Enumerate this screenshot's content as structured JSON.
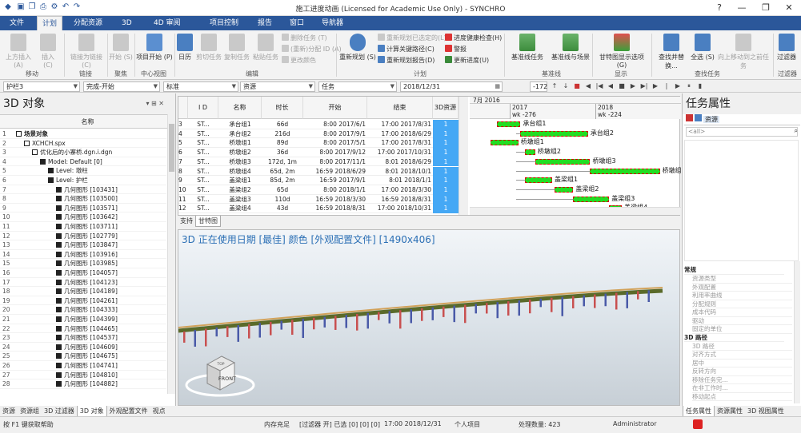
{
  "window": {
    "title": "施工进度动画 (Licensed for Academic Use Only) - SYNCHRO",
    "help": "?",
    "minimize": "—",
    "restore": "❐",
    "close": "✕"
  },
  "quick_access": [
    "save-icon",
    "open-icon",
    "print-icon",
    "settings-icon",
    "undo-icon",
    "redo-icon"
  ],
  "quick_access_glyphs": [
    "▣",
    "❐",
    "⎙",
    "⚙",
    "↶",
    "↷"
  ],
  "menu_tabs": [
    "文件",
    "计划",
    "分配资源",
    "3D",
    "4D 审阅",
    "项目控制",
    "报告",
    "窗口",
    "导航器"
  ],
  "active_tab": "计划",
  "ribbon": {
    "groups": [
      {
        "label": "移动",
        "buttons": [
          "上方插入 (A)",
          "插入 (C)"
        ]
      },
      {
        "label": "链接",
        "buttons": [
          "取消链接",
          "链接为链接 (C)"
        ]
      },
      {
        "label": "聚焦",
        "buttons": [
          "开始 (S)"
        ]
      },
      {
        "label": "中心视图",
        "buttons": [
          "项目开始 (P)"
        ]
      },
      {
        "label": "编辑",
        "buttons": [
          "日历",
          "剪切任务",
          "复制任务",
          "粘贴任务"
        ]
      },
      {
        "label": "计划",
        "buttons": [
          "重新规划 (S)"
        ]
      },
      {
        "label": "基准线",
        "buttons": [
          "基准线任务",
          "基准线与场景",
          "基准线"
        ]
      },
      {
        "label": "显示",
        "buttons": [
          "甘特图显示选项 (G)"
        ]
      },
      {
        "label": "查找任务",
        "buttons": [
          "查找并替换...",
          "全选 (S)",
          "向上移动到之前任务"
        ]
      },
      {
        "label": "过滤器",
        "buttons": [
          "过滤器"
        ]
      }
    ],
    "small": {
      "edit": [
        "删除任务 (T)",
        "(重新)分配 ID (A)",
        "更改颜色"
      ],
      "plan": [
        "重新规划已选定的(L)",
        "计算关键路径(C)",
        "重新规划报告(D)"
      ],
      "health": [
        "进度健康检查(H)",
        "警报",
        "更新进度(U)"
      ]
    }
  },
  "toolbar": {
    "obj": "护栏3",
    "status": "完成-开始",
    "std": "标准",
    "res": "资源",
    "task": "任务",
    "date": "2018/12/31",
    "num": "-172"
  },
  "left_panel": {
    "title": "3D 对象",
    "column": "名称",
    "rows": [
      {
        "n": "1",
        "t": "场景对象",
        "d": 0,
        "b": true
      },
      {
        "n": "2",
        "t": "XCHCH.spx",
        "d": 1
      },
      {
        "n": "3",
        "t": "优化后的小寨桥.dgn.i.dgn",
        "d": 2
      },
      {
        "n": "4",
        "t": "Model: Default [0]",
        "d": 3
      },
      {
        "n": "5",
        "t": "Level: 墩柱",
        "d": 4
      },
      {
        "n": "6",
        "t": "Level: 护栏",
        "d": 4
      },
      {
        "n": "7",
        "t": "几何图形 [103431]",
        "d": 5
      },
      {
        "n": "8",
        "t": "几何图形 [103500]",
        "d": 5
      },
      {
        "n": "9",
        "t": "几何图形 [103571]",
        "d": 5
      },
      {
        "n": "10",
        "t": "几何图形 [103642]",
        "d": 5
      },
      {
        "n": "11",
        "t": "几何图形 [103711]",
        "d": 5
      },
      {
        "n": "12",
        "t": "几何图形 [102779]",
        "d": 5
      },
      {
        "n": "13",
        "t": "几何图形 [103847]",
        "d": 5
      },
      {
        "n": "14",
        "t": "几何图形 [103916]",
        "d": 5
      },
      {
        "n": "15",
        "t": "几何图形 [103985]",
        "d": 5
      },
      {
        "n": "16",
        "t": "几何图形 [104057]",
        "d": 5
      },
      {
        "n": "17",
        "t": "几何图形 [104123]",
        "d": 5
      },
      {
        "n": "18",
        "t": "几何图形 [104189]",
        "d": 5
      },
      {
        "n": "19",
        "t": "几何图形 [104261]",
        "d": 5
      },
      {
        "n": "20",
        "t": "几何图形 [104333]",
        "d": 5
      },
      {
        "n": "21",
        "t": "几何图形 [104399]",
        "d": 5
      },
      {
        "n": "22",
        "t": "几何图形 [104465]",
        "d": 5
      },
      {
        "n": "23",
        "t": "几何图形 [104537]",
        "d": 5
      },
      {
        "n": "24",
        "t": "几何图形 [104609]",
        "d": 5
      },
      {
        "n": "25",
        "t": "几何图形 [104675]",
        "d": 5
      },
      {
        "n": "26",
        "t": "几何图形 [104741]",
        "d": 5
      },
      {
        "n": "27",
        "t": "几何图形 [104810]",
        "d": 5
      },
      {
        "n": "28",
        "t": "几何图形 [104882]",
        "d": 5
      }
    ],
    "bottom_tabs": [
      "资源",
      "资源组",
      "3D 过滤器",
      "3D 对象",
      "外观配置文件",
      "视点"
    ],
    "active_bottom": "3D 对象"
  },
  "gantt": {
    "headers": [
      "I\nD",
      "名称",
      "时长",
      "开始",
      "结束",
      "3D资源"
    ],
    "rows": [
      {
        "id": "3",
        "code": "ST...",
        "name": "承台组1",
        "dur": "66d",
        "start": "8:00 2017/6/1",
        "end": "17:00 2017/8/31",
        "res": "1"
      },
      {
        "id": "4",
        "code": "ST...",
        "name": "承台组2",
        "dur": "216d",
        "start": "8:00 2017/9/1",
        "end": "17:00 2018/6/29",
        "res": "1"
      },
      {
        "id": "5",
        "code": "ST...",
        "name": "桥墩组1",
        "dur": "89d",
        "start": "8:00 2017/5/1",
        "end": "17:00 2017/8/31",
        "res": "1"
      },
      {
        "id": "6",
        "code": "ST...",
        "name": "桥墩组2",
        "dur": "36d",
        "start": "8:00 2017/9/12",
        "end": "17:00 2017/10/31",
        "res": "1"
      },
      {
        "id": "7",
        "code": "ST...",
        "name": "桥墩组3",
        "dur": "172d, 1m",
        "start": "8:00 2017/11/1",
        "end": "8:01 2018/6/29",
        "res": "1"
      },
      {
        "id": "8",
        "code": "ST...",
        "name": "桥墩组4",
        "dur": "65d, 2m",
        "start": "16:59 2018/6/29",
        "end": "8:01 2018/10/1",
        "res": "1"
      },
      {
        "id": "9",
        "code": "ST...",
        "name": "盖梁组1",
        "dur": "85d, 2m",
        "start": "16:59 2017/9/1",
        "end": "8:01 2018/1/1",
        "res": "1"
      },
      {
        "id": "10",
        "code": "ST...",
        "name": "盖梁组2",
        "dur": "65d",
        "start": "8:00 2018/1/1",
        "end": "17:00 2018/3/30",
        "res": "1"
      },
      {
        "id": "11",
        "code": "ST...",
        "name": "盖梁组3",
        "dur": "110d",
        "start": "16:59 2018/3/30",
        "end": "16:59 2018/8/31",
        "res": "1"
      },
      {
        "id": "12",
        "code": "ST...",
        "name": "盖梁组4",
        "dur": "43d",
        "start": "16:59 2018/8/31",
        "end": "17:00 2018/10/31",
        "res": "1"
      }
    ],
    "timeline": {
      "top": "7月 2016",
      "y1": "2017",
      "wk1": "wk -276",
      "y2": "2018",
      "wk2": "wk -224"
    },
    "bars": [
      {
        "label": "承台组1",
        "s": 0.13,
        "e": 0.24,
        "row": 0,
        "lblTop": true
      },
      {
        "label": "承台组2",
        "s": 0.24,
        "e": 0.56,
        "row": 1
      },
      {
        "label": "桥墩组1",
        "s": 0.1,
        "e": 0.23,
        "row": 2
      },
      {
        "label": "桥墩组2",
        "s": 0.26,
        "e": 0.31,
        "row": 3
      },
      {
        "label": "桥墩组3",
        "s": 0.31,
        "e": 0.57,
        "row": 4
      },
      {
        "label": "桥墩组4",
        "s": 0.57,
        "e": 0.9,
        "row": 5
      },
      {
        "label": "盖梁组1",
        "s": 0.26,
        "e": 0.39,
        "row": 6
      },
      {
        "label": "盖梁组2",
        "s": 0.4,
        "e": 0.49,
        "row": 7
      },
      {
        "label": "盖梁组3",
        "s": 0.49,
        "e": 0.66,
        "row": 8
      },
      {
        "label": "盖梁组4",
        "s": 0.66,
        "e": 0.72,
        "row": 9
      }
    ],
    "tabs": [
      "支持",
      "甘特图"
    ],
    "active_tab": "甘特图"
  },
  "view3d": {
    "header": "3D 正在使用日期 [最佳] 颜色 [外观配置文件]  [1490x406]",
    "cube_front": "FRONT",
    "cube_top": "TOP"
  },
  "right_panel": {
    "title": "任务属性",
    "res_tab": "资源",
    "search": "<all>",
    "sections": [
      {
        "title": "常规",
        "items": [
          "资源类型",
          "外观配置",
          "利用率曲线",
          "分配规则",
          "成本代码",
          "驱动",
          "固定的单位"
        ]
      },
      {
        "title": "3D 路径",
        "items": [
          "3D 路径",
          "对齐方式",
          "居中",
          "反转方向",
          "移除任务完...",
          "在非工作时...",
          "移动起点"
        ]
      }
    ],
    "bottom_tabs": [
      "任务属性",
      "资源属性",
      "3D 视图属性"
    ],
    "active_bottom": "任务属性"
  },
  "status": {
    "help": "按 F1 键获取帮助",
    "mem": "内存充足",
    "filter": "[过滤器 开] 已选 [0] [0] [0]",
    "time": "17:00 2018/12/31",
    "project": "个人项目",
    "count": "处理数量: 423",
    "user": "Administrator"
  },
  "colors": {
    "ribbon_tab": "#2b579a",
    "bar": "#22dd22",
    "bar_border": "#dd0000",
    "res": "#45a8f5",
    "header3d": "#2b6fb5"
  }
}
